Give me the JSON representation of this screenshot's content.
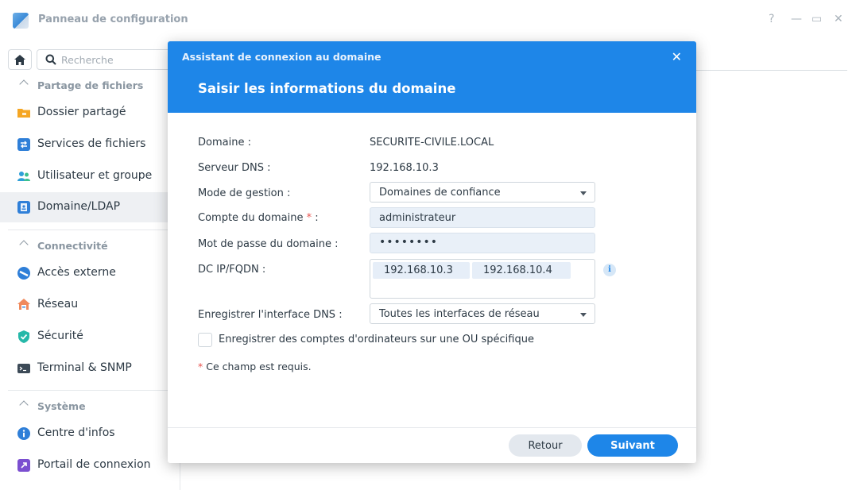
{
  "window": {
    "title": "Panneau de configuration",
    "controls": {
      "help": "?",
      "minimize": "—",
      "maximize": "▭",
      "close": "✕"
    }
  },
  "sidebar": {
    "search_placeholder": "Recherche",
    "sections": [
      {
        "label": "Partage de fichiers"
      },
      {
        "label": "Connectivité"
      },
      {
        "label": "Système"
      }
    ],
    "items": [
      {
        "label": "Dossier partagé",
        "icon": "folder-icon"
      },
      {
        "label": "Services de fichiers",
        "icon": "file-services-icon"
      },
      {
        "label": "Utilisateur et groupe",
        "icon": "users-icon"
      },
      {
        "label": "Domaine/LDAP",
        "icon": "domain-ldap-icon",
        "active": true
      },
      {
        "label": "Accès externe",
        "icon": "external-access-icon"
      },
      {
        "label": "Réseau",
        "icon": "network-house-icon"
      },
      {
        "label": "Sécurité",
        "icon": "security-shield-icon"
      },
      {
        "label": "Terminal & SNMP",
        "icon": "terminal-icon"
      },
      {
        "label": "Centre d'infos",
        "icon": "info-center-icon"
      },
      {
        "label": "Portail de connexion",
        "icon": "login-portal-icon"
      }
    ]
  },
  "modal": {
    "title": "Assistant de connexion au domaine",
    "close": "✕",
    "step_title": "Saisir les informations du domaine",
    "fields": {
      "domain": {
        "label": "Domaine :",
        "value": "SECURITE-CIVILE.LOCAL"
      },
      "dns_server": {
        "label": "Serveur DNS :",
        "value": "192.168.10.3"
      },
      "mode": {
        "label": "Mode de gestion :",
        "value": "Domaines de confiance"
      },
      "account": {
        "label": "Compte du domaine",
        "required_mark": "*",
        "suffix": ":",
        "value": "administrateur"
      },
      "password": {
        "label": "Mot de passe du domaine :",
        "value": "••••••••"
      },
      "dc": {
        "label": "DC IP/FQDN :",
        "tags": [
          "192.168.10.3",
          "192.168.10.4"
        ]
      },
      "dns_interface": {
        "label": "Enregistrer l'interface DNS :",
        "value": "Toutes les interfaces de réseau"
      }
    },
    "checkbox_label": "Enregistrer des comptes d'ordinateurs sur une OU spécifique",
    "checkbox_checked": false,
    "required_note_mark": "*",
    "required_note": "Ce champ est requis.",
    "info_glyph": "i",
    "buttons": {
      "back": "Retour",
      "next": "Suivant"
    }
  },
  "colors": {
    "accent": "#1e86e8",
    "required": "#e8534f",
    "active_item_bg": "#eef0f3"
  }
}
